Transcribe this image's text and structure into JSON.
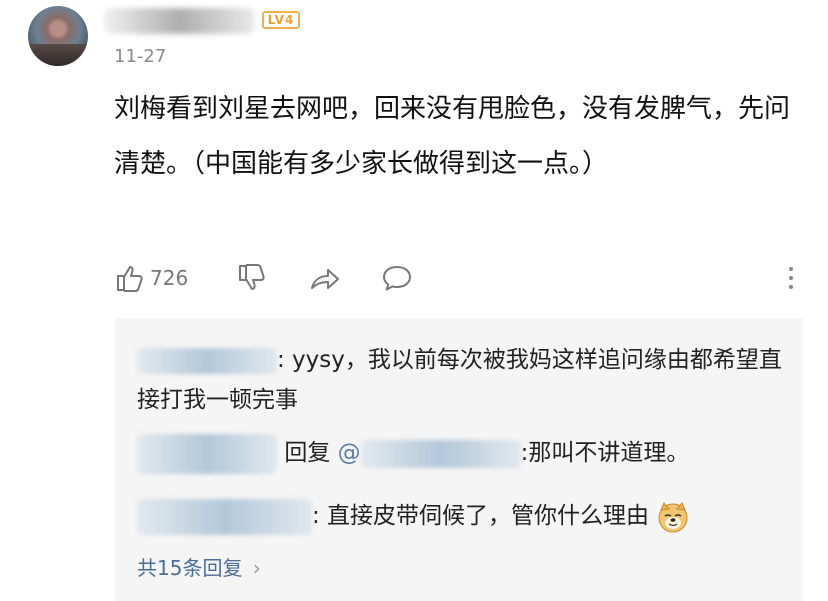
{
  "comment": {
    "level": "LV4",
    "date": "11-27",
    "text": "刘梅看到刘星去网吧，回来没有甩脸色，没有发脾气，先问清楚。（中国能有多少家长做得到这一点。）",
    "like_count": "726"
  },
  "icons": [
    "like-icon",
    "dislike-icon",
    "share-icon",
    "comment-icon",
    "more-icon"
  ],
  "replies": [
    {
      "text": ": yysy，我以前每次被我妈这样追问缘由都希望直接打我一顿完事"
    },
    {
      "reply_word": "回复",
      "at": "@",
      "text": ":那叫不讲道理。"
    },
    {
      "text": ": 直接皮带伺候了，管你什么理由"
    }
  ],
  "more_replies": "共15条回复",
  "colors": {
    "link": "#4a6d9a",
    "badge": "#f0a030",
    "reply_bg": "#f5f5f5"
  }
}
